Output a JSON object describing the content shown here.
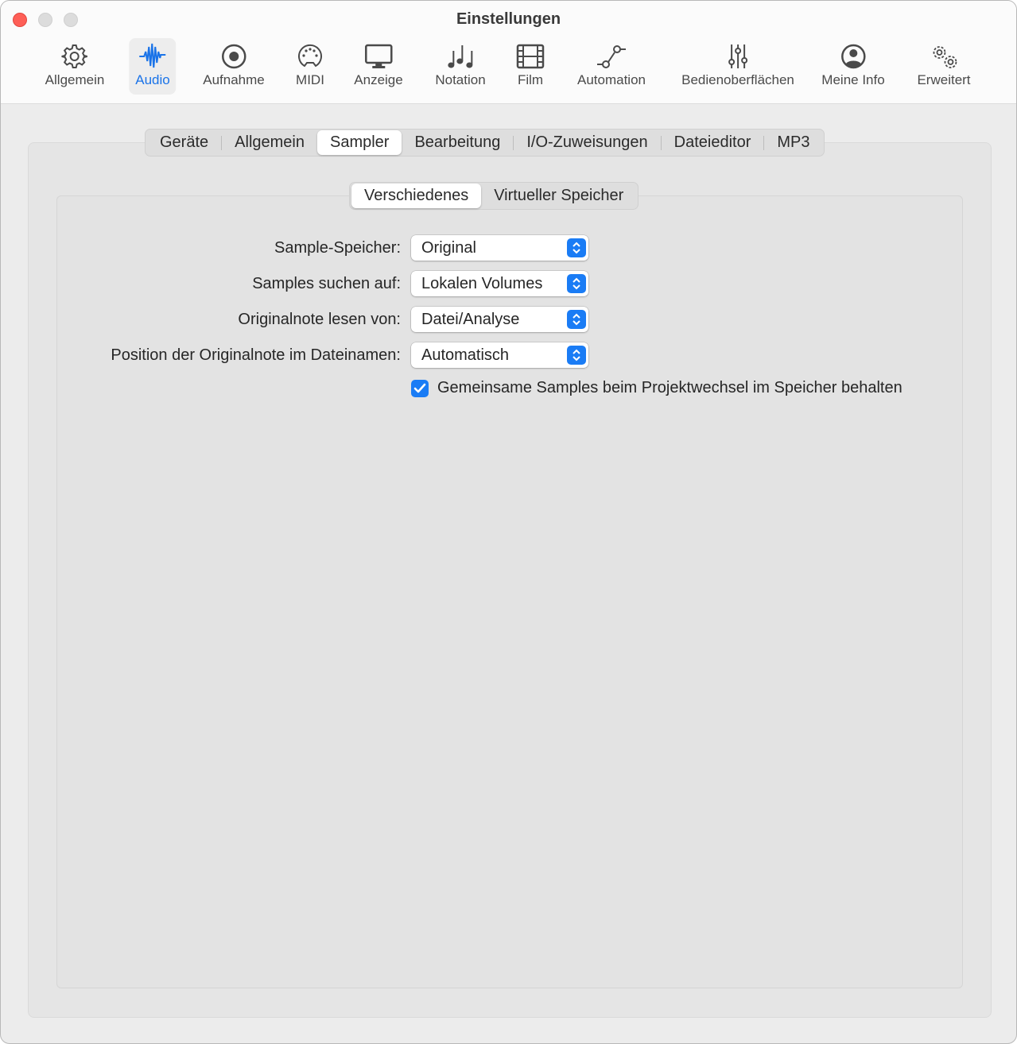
{
  "window": {
    "title": "Einstellungen"
  },
  "toolbar": [
    {
      "label": "Allgemein",
      "icon": "gear-icon"
    },
    {
      "label": "Audio",
      "icon": "waveform-icon",
      "selected": true
    },
    {
      "label": "Aufnahme",
      "icon": "record-icon"
    },
    {
      "label": "MIDI",
      "icon": "midi-port-icon"
    },
    {
      "label": "Anzeige",
      "icon": "display-icon"
    },
    {
      "label": "Notation",
      "icon": "music-notes-icon"
    },
    {
      "label": "Film",
      "icon": "film-icon"
    },
    {
      "label": "Automation",
      "icon": "automation-curve-icon"
    },
    {
      "label": "Bedienoberflächen",
      "icon": "sliders-icon"
    },
    {
      "label": "Meine Info",
      "icon": "person-circle-icon"
    },
    {
      "label": "Erweitert",
      "icon": "gears-icon"
    }
  ],
  "tabs": [
    "Geräte",
    "Allgemein",
    "Sampler",
    "Bearbeitung",
    "I/O-Zuweisungen",
    "Dateieditor",
    "MP3"
  ],
  "selected_tab": "Sampler",
  "subtabs": [
    "Verschiedenes",
    "Virtueller Speicher"
  ],
  "selected_subtab": "Verschiedenes",
  "form": [
    {
      "label": "Sample-Speicher:",
      "value": "Original"
    },
    {
      "label": "Samples suchen auf:",
      "value": "Lokalen Volumes"
    },
    {
      "label": "Originalnote lesen von:",
      "value": "Datei/Analyse"
    },
    {
      "label": "Position der Originalnote im Dateinamen:",
      "value": "Automatisch"
    }
  ],
  "checkbox": {
    "label": "Gemeinsame Samples beim Projektwechsel im Speicher behalten",
    "checked": true
  },
  "colors": {
    "accent": "#1a7cf5",
    "close": "#fe5f57"
  }
}
